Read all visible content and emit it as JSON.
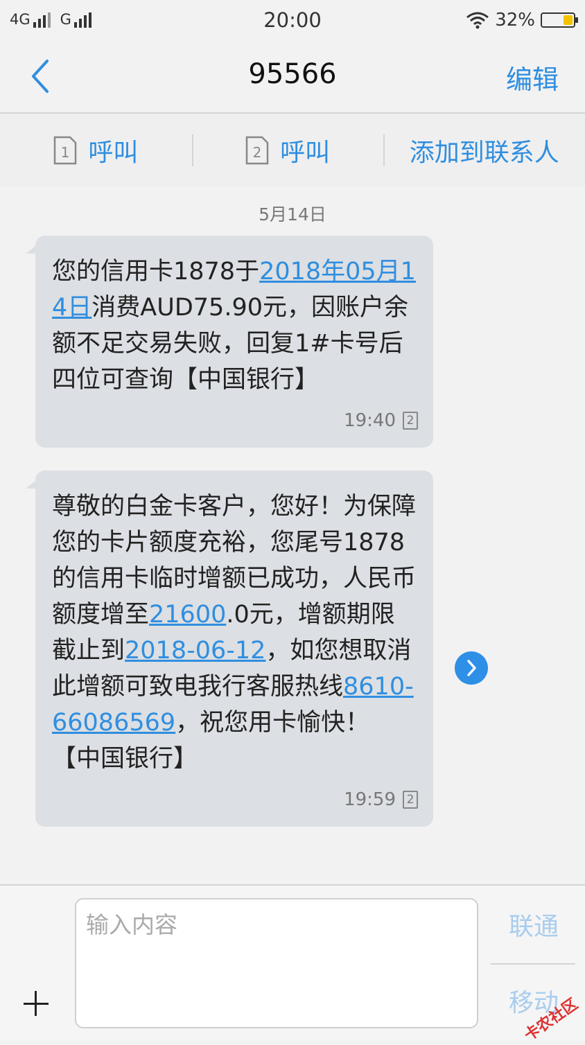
{
  "status_bar": {
    "network1": "4G",
    "network2": "G",
    "time": "20:00",
    "battery": "32%",
    "battery_level": 0.32
  },
  "header": {
    "title": "95566",
    "edit": "编辑",
    "back_icon": "chevron-left-icon"
  },
  "actions": {
    "call1_sim": "1",
    "call1_label": "呼叫",
    "call2_sim": "2",
    "call2_label": "呼叫",
    "add_contact": "添加到联系人"
  },
  "conversation": {
    "date": "5月14日",
    "messages": [
      {
        "t1": "您的信用卡1878于",
        "link1": "2018年05月14日",
        "t2": "消费AUD75.90元，因账户余额不足交易失败，回复1#卡号后四位可查询【中国银行】",
        "time": "19:40",
        "sim": "2"
      },
      {
        "t1": "尊敬的白金卡客户，您好！为保障您的卡片额度充裕，您尾号1878的信用卡临时增额已成功，人民币额度增至",
        "link1": "21600",
        "t2": ".0元，增额期限截止到",
        "link2": "2018-06-12",
        "t3": "，如您想取消此增额可致电我行客服热线",
        "link3": "8610-66086569",
        "t4": "，祝您用卡愉快！【中国银行】",
        "time": "19:59",
        "sim": "2"
      }
    ]
  },
  "composer": {
    "placeholder": "输入内容",
    "send_sim1": "联通",
    "send_sim2": "移动",
    "watermark": "卡农社区"
  },
  "colors": {
    "accent": "#2f8ee0",
    "bubble": "#dcdfe3"
  }
}
